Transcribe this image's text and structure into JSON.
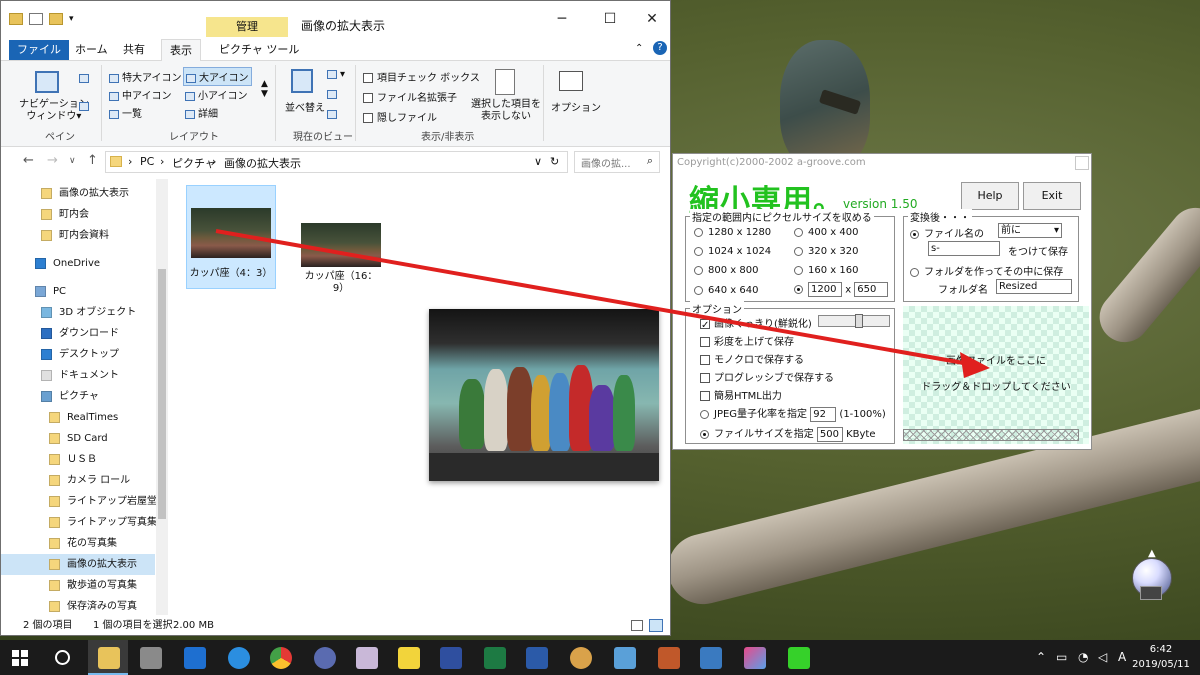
{
  "explorer": {
    "title": "画像の拡大表示",
    "manage_tab": "管理",
    "ribbon_tabs": [
      "ファイル",
      "ホーム",
      "共有",
      "表示",
      "ピクチャ ツール"
    ],
    "ribbon": {
      "pane_group": {
        "nav_pane": "ナビゲーション\nウィンドウ▾",
        "label": "ペイン"
      },
      "layout_items": [
        "特大アイコン",
        "大アイコン",
        "中アイコン",
        "小アイコン",
        "一覧",
        "詳細"
      ],
      "layout_label": "レイアウト",
      "view_group": {
        "sort": "並べ替え",
        "label": "現在のビュー"
      },
      "show_hide": {
        "items": [
          "項目チェック ボックス",
          "ファイル名拡張子",
          "隠しファイル"
        ],
        "hide_selected": "選択した項目を\n表示しない",
        "label": "表示/非表示"
      },
      "options": "オプション"
    },
    "address": {
      "pc": "PC",
      "pictures": "ピクチャ",
      "folder": "画像の拡大表示",
      "search_placeholder": "画像の拡..."
    },
    "nav_items": [
      {
        "label": "画像の拡大表示",
        "icon": "folder-icon"
      },
      {
        "label": "町内会",
        "icon": "folder-icon"
      },
      {
        "label": "町内会資料",
        "icon": "folder-icon"
      },
      {
        "label": "OneDrive",
        "icon": "cloud-icon"
      },
      {
        "label": "PC",
        "icon": "computer-icon"
      },
      {
        "label": "3D オブジェクト",
        "icon": "cube-icon"
      },
      {
        "label": "ダウンロード",
        "icon": "download-icon"
      },
      {
        "label": "デスクトップ",
        "icon": "desktop-icon"
      },
      {
        "label": "ドキュメント",
        "icon": "document-icon"
      },
      {
        "label": "ピクチャ",
        "icon": "pictures-icon"
      },
      {
        "label": "RealTimes",
        "icon": "folder-icon"
      },
      {
        "label": "SD Card",
        "icon": "folder-icon"
      },
      {
        "label": "ＵＳＢ",
        "icon": "folder-icon"
      },
      {
        "label": "カメラ ロール",
        "icon": "folder-icon"
      },
      {
        "label": "ライトアップ岩屋堂",
        "icon": "folder-icon"
      },
      {
        "label": "ライトアップ写真集",
        "icon": "folder-icon"
      },
      {
        "label": "花の写真集",
        "icon": "folder-icon"
      },
      {
        "label": "画像の拡大表示",
        "icon": "folder-icon"
      },
      {
        "label": "散歩道の写真集",
        "icon": "folder-icon"
      },
      {
        "label": "保存済みの写真",
        "icon": "folder-icon"
      }
    ],
    "files": [
      {
        "name": "カッパ座（4：3）"
      },
      {
        "name": "カッパ座（16：9）"
      }
    ],
    "status": {
      "count": "2 個の項目",
      "selected": "1 個の項目を選択",
      "size": "2.00 MB"
    }
  },
  "app": {
    "copyright": "Copyright(c)2000-2002 a-groove.com",
    "logo": "縮小専用。",
    "version": "version 1.50",
    "help": "Help",
    "exit": "Exit",
    "size_group": {
      "label": "指定の範囲内にピクセルサイズを収める",
      "left": [
        "1280 x 1280",
        "1024 x 1024",
        "800 x 800",
        "640 x 640"
      ],
      "right": [
        "400 x 400",
        "320 x 320",
        "160 x 160"
      ],
      "custom_w": "1200",
      "custom_x": "x",
      "custom_h": "650"
    },
    "after_group": {
      "label": "変換後・・・",
      "filename_label": "ファイル名の",
      "position": "前に",
      "prefix": "s-",
      "suffix_label": "をつけて保存",
      "folder_option": "フォルダを作ってその中に保存",
      "folder_name_label": "フォルダ名",
      "folder_name": "Resized"
    },
    "options_group": {
      "label": "オプション",
      "sharpen": "画像くっきり(鮮鋭化)",
      "saturation": "彩度を上げて保存",
      "mono": "モノクロで保存する",
      "progressive": "プログレッシブで保存する",
      "html": "簡易HTML出力",
      "jpeg_q": "JPEG量子化率を指定",
      "jpeg_value": "92",
      "jpeg_range": "(1-100%)",
      "filesize": "ファイルサイズを指定",
      "filesize_value": "500",
      "filesize_unit": "KByte"
    },
    "drop_text_1": "画像ファイルをここに",
    "drop_text_2": "ドラッグ＆ドロップしてください"
  },
  "taskbar": {
    "time": "6:42",
    "date": "2019/05/11",
    "ime": "A"
  }
}
